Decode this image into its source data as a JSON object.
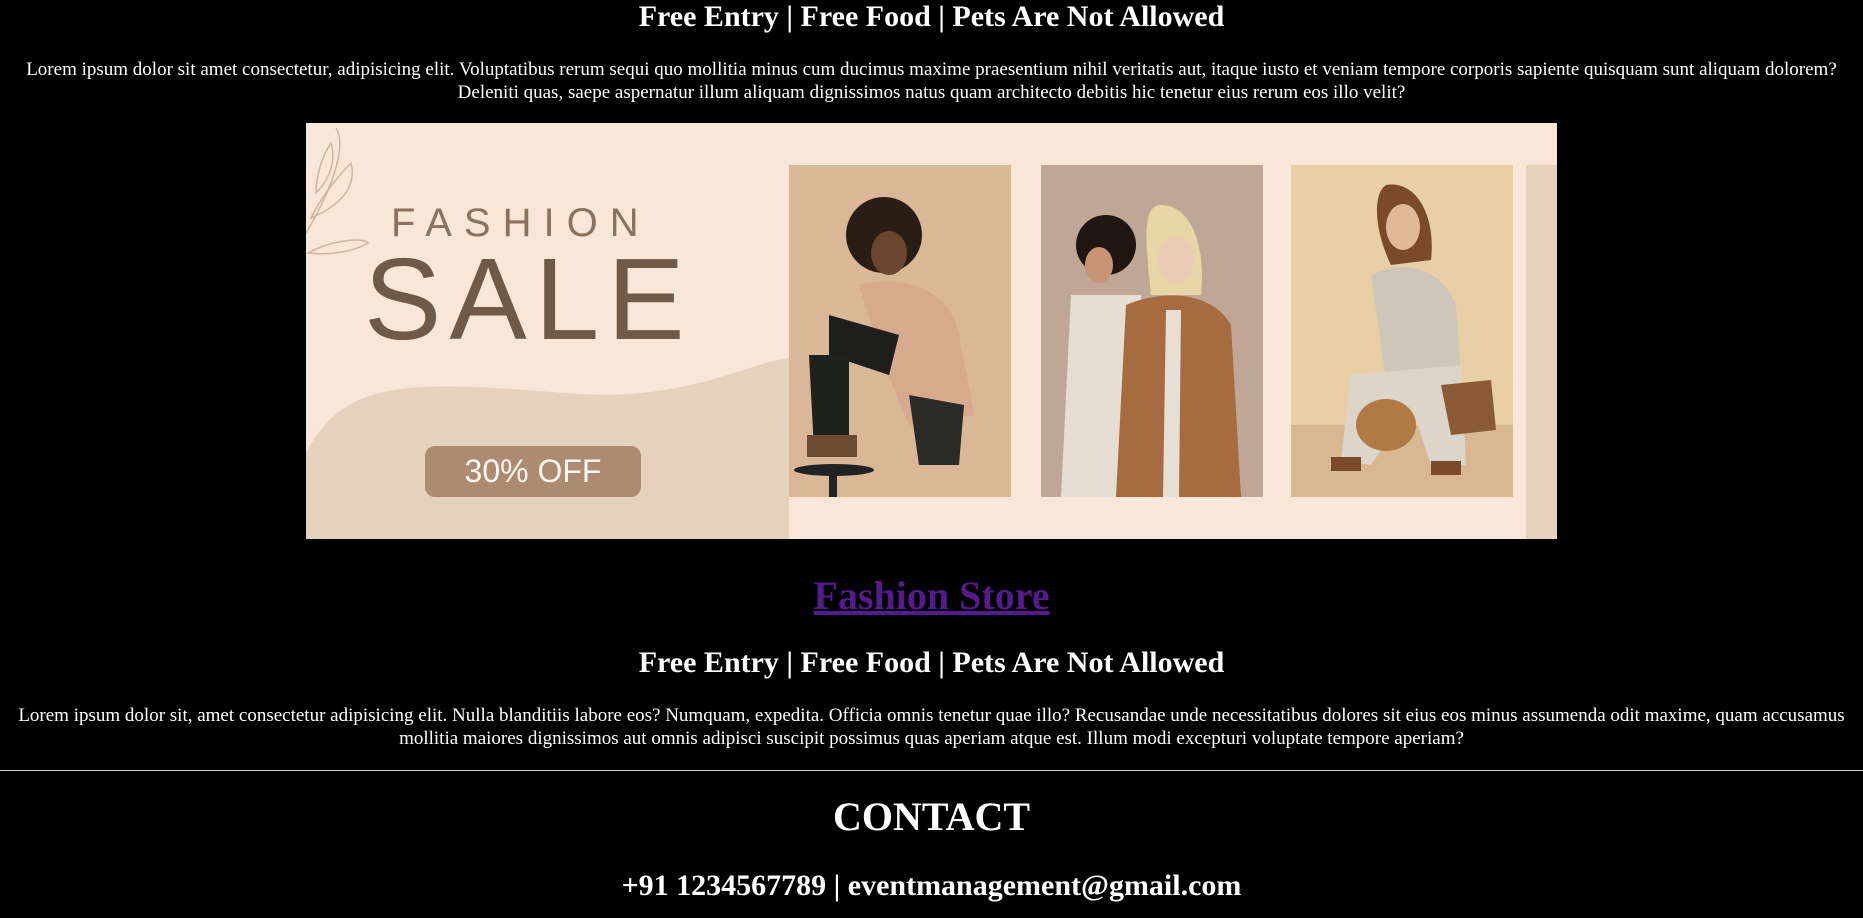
{
  "top": {
    "heading": "Free Entry | Free Food | Pets Are Not Allowed",
    "paragraph": "Lorem ipsum dolor sit amet consectetur, adipisicing elit. Voluptatibus rerum sequi quo mollitia minus cum ducimus maxime praesentium nihil veritatis aut, itaque iusto et veniam tempore corporis sapiente quisquam sunt aliquam dolorem? Deleniti quas, saepe aspernatur illum aliquam dignissimos natus quam architecto debitis hic tenetur eius rerum eos illo velit?"
  },
  "banner": {
    "fashion_text": "FASHION",
    "sale_text": "SALE",
    "offer_text": "30% OFF",
    "colors": {
      "background": "#f8e6d8",
      "wave": "#e6d1bd",
      "text_dark": "#6f5a49",
      "offer_bg": "#ad8b73"
    }
  },
  "store": {
    "link_label": "Fashion Store",
    "link_color": "#551a8b"
  },
  "middle": {
    "heading": "Free Entry | Free Food | Pets Are Not Allowed",
    "paragraph": "Lorem ipsum dolor sit, amet consectetur adipisicing elit. Nulla blanditiis labore eos? Numquam, expedita. Officia omnis tenetur quae illo? Recusandae unde necessitatibus dolores sit eius eos minus assumenda odit maxime, quam accusamus mollitia maiores dignissimos aut omnis adipisci suscipit possimus quas aperiam atque est. Illum modi excepturi voluptate tempore aperiam?"
  },
  "contact": {
    "title": "CONTACT",
    "details": "+91 1234567789 | eventmanagement@gmail.com"
  }
}
